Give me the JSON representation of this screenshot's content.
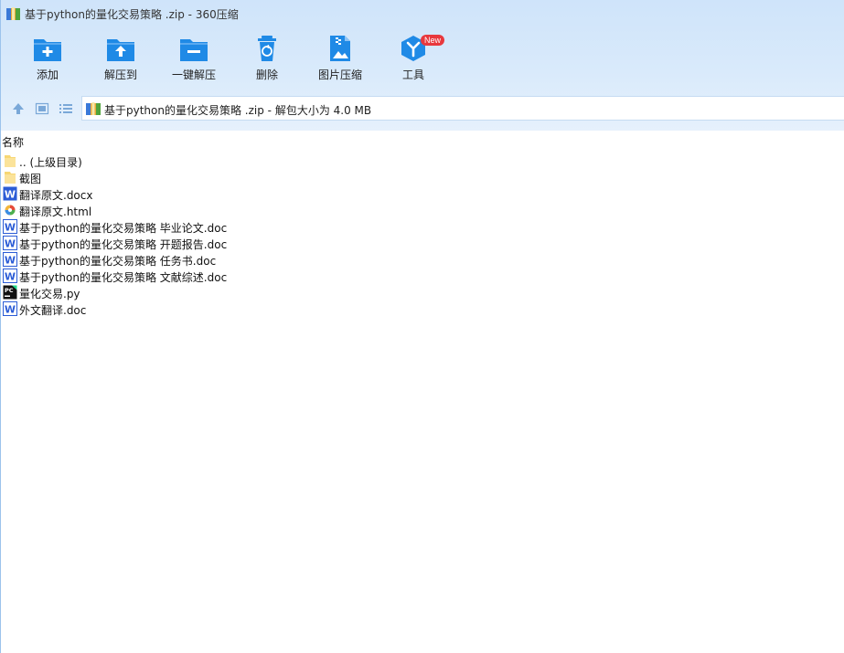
{
  "window": {
    "title": "基于python的量化交易策略 .zip - 360压缩"
  },
  "toolbar": {
    "buttons": [
      {
        "label": "添加",
        "icon": "add-folder-icon"
      },
      {
        "label": "解压到",
        "icon": "extract-to-icon"
      },
      {
        "label": "一键解压",
        "icon": "one-click-extract-icon"
      },
      {
        "label": "删除",
        "icon": "trash-icon"
      },
      {
        "label": "图片压缩",
        "icon": "image-compress-icon"
      },
      {
        "label": "工具",
        "icon": "tools-cube-icon",
        "badge": "New"
      }
    ]
  },
  "navigation": {
    "address": "基于python的量化交易策略 .zip - 解包大小为 4.0 MB"
  },
  "file_list": {
    "column_name": "名称",
    "items": [
      {
        "name": ".. (上级目录)",
        "type": "folder"
      },
      {
        "name": "截图",
        "type": "folder"
      },
      {
        "name": "翻译原文.docx",
        "type": "docx"
      },
      {
        "name": "翻译原文.html",
        "type": "html"
      },
      {
        "name": "基于python的量化交易策略 毕业论文.doc",
        "type": "doc"
      },
      {
        "name": "基于python的量化交易策略 开题报告.doc",
        "type": "doc"
      },
      {
        "name": "基于python的量化交易策略 任务书.doc",
        "type": "doc"
      },
      {
        "name": "基于python的量化交易策略 文献综述.doc",
        "type": "doc"
      },
      {
        "name": "量化交易.py",
        "type": "py"
      },
      {
        "name": "外文翻译.doc",
        "type": "doc"
      }
    ]
  },
  "colors": {
    "accent": "#1f8ae6",
    "header_bg": "#d6e8fb",
    "badge": "#e8383d"
  }
}
